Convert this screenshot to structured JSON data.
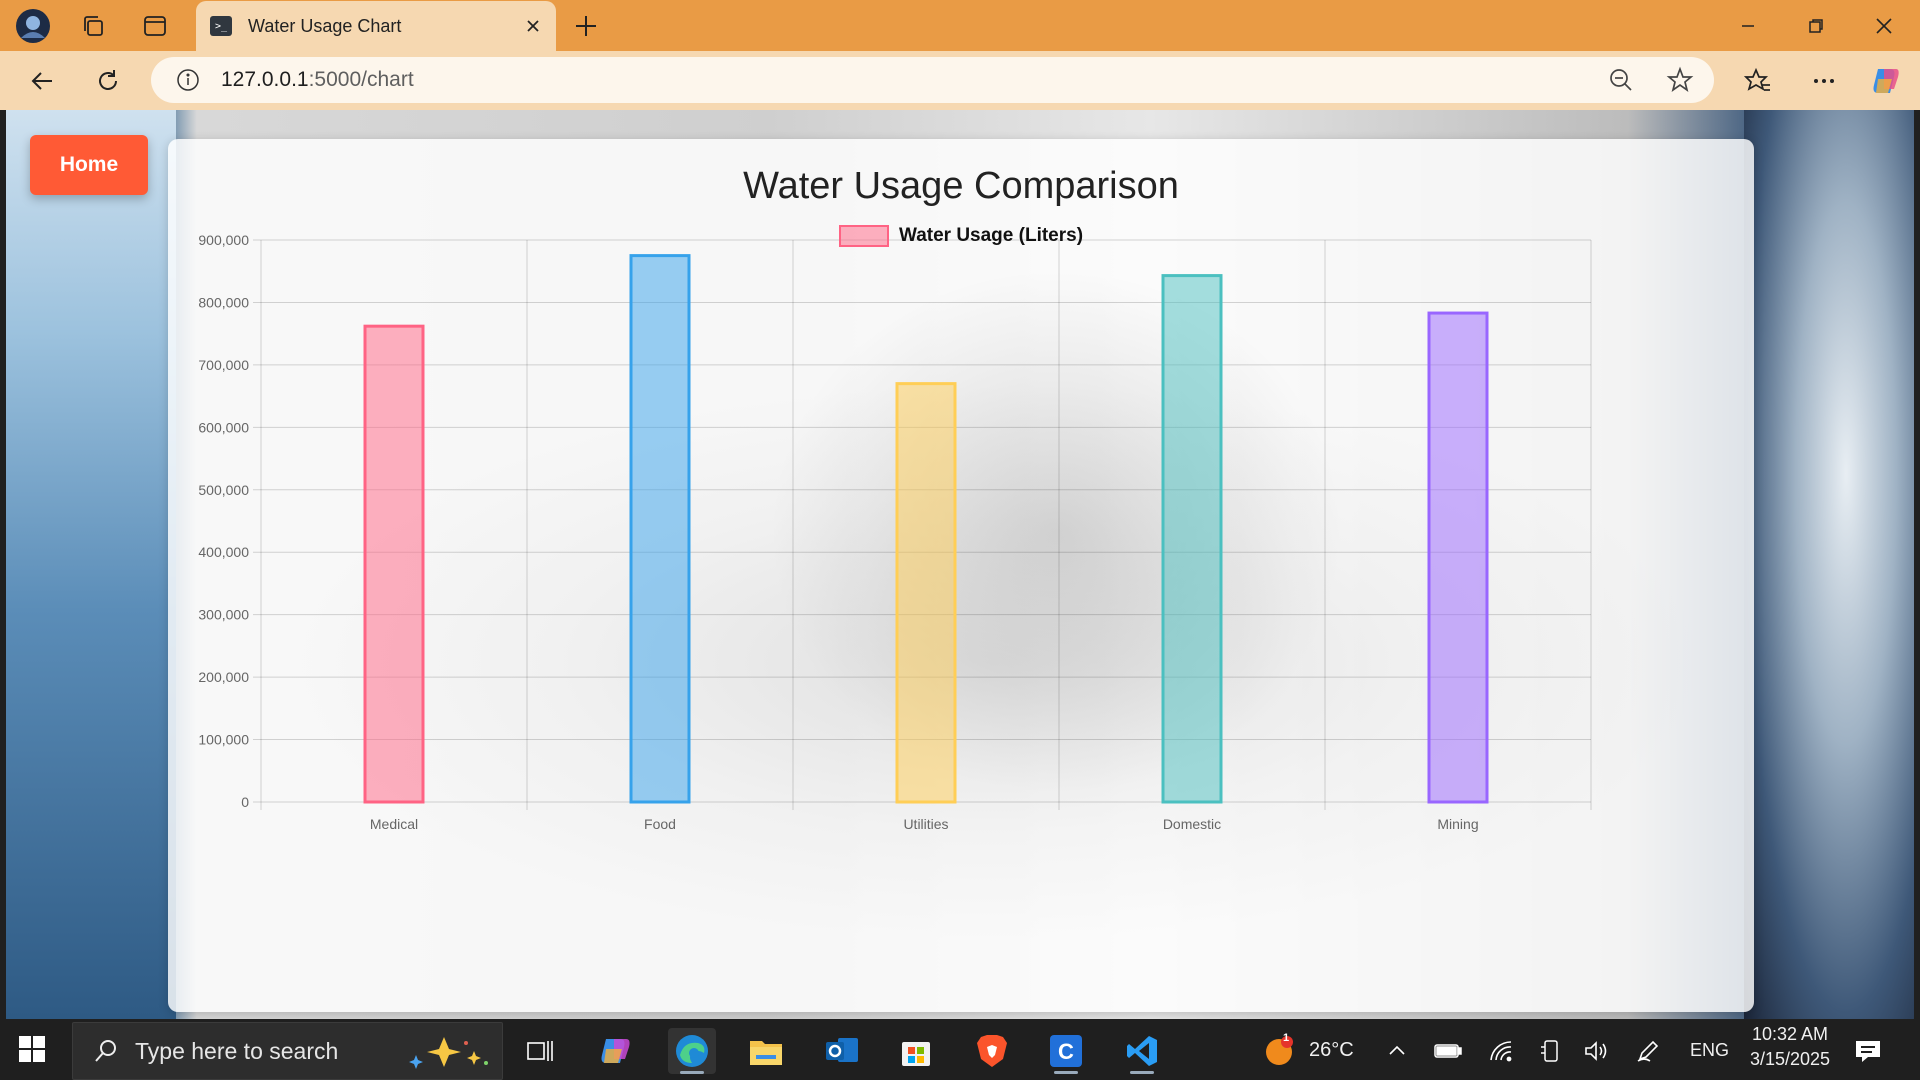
{
  "browser": {
    "tab_title": "Water Usage Chart",
    "favicon_text": ">_",
    "url_host": "127.0.0.1",
    "url_path": ":5000/chart"
  },
  "page": {
    "home_label": "Home"
  },
  "chart_data": {
    "type": "bar",
    "title": "Water Usage Comparison",
    "categories": [
      "Medical",
      "Food",
      "Utilities",
      "Domestic",
      "Mining"
    ],
    "series": [
      {
        "name": "Water Usage (Liters)",
        "values": [
          762000,
          875000,
          670000,
          843000,
          783000
        ],
        "fill_colors": [
          "rgba(255,99,132,0.5)",
          "rgba(54,162,235,0.5)",
          "rgba(255,206,86,0.5)",
          "rgba(75,192,192,0.5)",
          "rgba(153,102,255,0.5)"
        ],
        "border_colors": [
          "#ff6384",
          "#36a2eb",
          "#ffce56",
          "#4bc0c0",
          "#9966ff"
        ]
      }
    ],
    "ylim": [
      0,
      900000
    ],
    "yticks": [
      "0",
      "100,000",
      "200,000",
      "300,000",
      "400,000",
      "500,000",
      "600,000",
      "700,000",
      "800,000",
      "900,000"
    ],
    "grid": true,
    "legend_position": "top"
  },
  "taskbar": {
    "search_placeholder": "Type here to search",
    "weather_badge": "1",
    "temperature": "26°C",
    "language": "ENG",
    "time": "10:32 AM",
    "date": "3/15/2025"
  }
}
